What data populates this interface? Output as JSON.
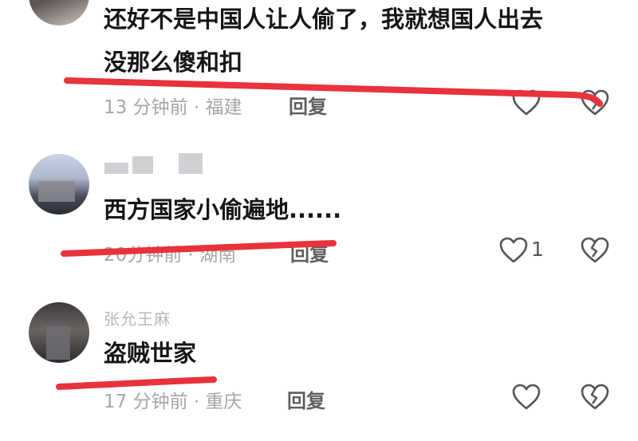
{
  "comments": [
    {
      "username": "",
      "text_line1": "还好不是中国人让人偷了，我就想国人出去",
      "text_line2": "没那么傻和扣",
      "time": "13 分钟前",
      "location": "福建",
      "reply_label": "回复",
      "like_count": ""
    },
    {
      "username": "",
      "text_line1": "西方国家小偷遍地......",
      "time": "20分钟前",
      "location": "湖南",
      "reply_label": "回复",
      "like_count": "1"
    },
    {
      "username": "张允王麻",
      "text_line1": "盗贼世家",
      "time": "17 分钟前",
      "location": "重庆",
      "reply_label": "回复",
      "like_count": ""
    }
  ],
  "icons": {
    "like": "heart-icon",
    "dislike": "broken-heart-icon"
  },
  "colors": {
    "annotation_red": "#e8323c",
    "meta_gray": "#a6a6a6"
  }
}
